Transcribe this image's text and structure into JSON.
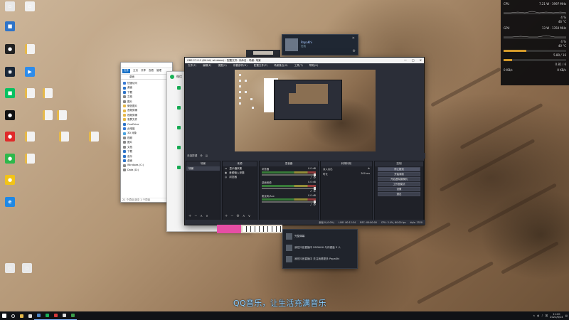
{
  "desktop": {
    "icons": [
      {
        "label": "",
        "color": "#e8e8e8",
        "glyph": "▫"
      },
      {
        "label": "",
        "color": "#f0f0f0",
        "glyph": "▫"
      },
      {
        "label": "",
        "color": "#2f74c8",
        "glyph": "■"
      },
      {
        "label": "",
        "color": "#222222",
        "glyph": "●"
      },
      {
        "label": "",
        "color": "#1b2838",
        "glyph": "◉"
      },
      {
        "label": "",
        "color": "#2d8ceb",
        "glyph": "▶"
      },
      {
        "label": "",
        "color": "#07c160",
        "glyph": "■"
      },
      {
        "label": "",
        "color": "#111111",
        "glyph": "●"
      },
      {
        "label": "",
        "color": "#e02a2a",
        "glyph": "●"
      },
      {
        "label": "",
        "color": "#2eb84b",
        "glyph": "●"
      },
      {
        "label": "",
        "color": "#f2c318",
        "glyph": "●"
      },
      {
        "label": "",
        "color": "#1e88e5",
        "glyph": "e"
      },
      {
        "label": "",
        "color": "#e8e8e8",
        "glyph": "▫"
      },
      {
        "label": "",
        "color": "#e8e8e8",
        "glyph": "▫"
      }
    ]
  },
  "hwmon": {
    "cpu_label": "CPU",
    "cpu_detail": "7.21 W  ·  3997 MHz",
    "cpu_usage": "4 %",
    "cpu_temp": "46 °C",
    "gpu_label": "GPU",
    "gpu_detail": "13 W  ·  1350 MHz",
    "gpu_usage": "4 %",
    "gpu_temp": "40 °C",
    "ram_value": "5.80 / 16",
    "vram_value": "0.81 / 6",
    "net_down": "0 KB/s",
    "net_up": "0 KB/s"
  },
  "explorer": {
    "tabs": [
      "文件",
      "主页",
      "共享",
      "查看",
      "管理"
    ],
    "path": "桌面",
    "nav": [
      {
        "label": "快速访问",
        "color": "#3a7bd5"
      },
      {
        "label": "桌面",
        "color": "#2f74c8"
      },
      {
        "label": "下载",
        "color": "#2f74c8"
      },
      {
        "label": "文档",
        "color": "#888888"
      },
      {
        "label": "图片",
        "color": "#888888"
      },
      {
        "label": "微信图片",
        "color": "#e6b94a"
      },
      {
        "label": "音频剪辑",
        "color": "#e6b94a"
      },
      {
        "label": "视频剪辑",
        "color": "#e6b94a"
      },
      {
        "label": "录屏文件",
        "color": "#e6b94a"
      },
      {
        "label": "OneDrive",
        "color": "#2f74c8"
      },
      {
        "label": "此电脑",
        "color": "#3a7bd5"
      },
      {
        "label": "3D 对象",
        "color": "#4aa3df"
      },
      {
        "label": "视频",
        "color": "#888888"
      },
      {
        "label": "图片",
        "color": "#888888"
      },
      {
        "label": "文档",
        "color": "#888888"
      },
      {
        "label": "下载",
        "color": "#2f74c8"
      },
      {
        "label": "音乐",
        "color": "#2f74c8"
      },
      {
        "label": "桌面",
        "color": "#2f74c8"
      },
      {
        "label": "Windows (C:)",
        "color": "#888888"
      },
      {
        "label": "Data (D:)",
        "color": "#888888"
      }
    ],
    "status": "21 个项目  选中 1 个项目"
  },
  "greenapp": {
    "title": "微信"
  },
  "steam_popup": {
    "name": "PapaKhi",
    "status": "在线"
  },
  "notifications": [
    {
      "text": "完整弹幕"
    },
    {
      "text": "我在抖音直播中  PAPAKHI·与你重逢 3 人"
    },
    {
      "text": "我在抖音直播中  关注我看更多 PapaKhi"
    }
  ],
  "obs": {
    "title": "OBS 27.0.1 (64-bit, windows) - 配置文件: 未命名 - 场景: 场景",
    "window_controls": [
      "—",
      "□",
      "✕"
    ],
    "menu": [
      "文件(F)",
      "编辑(E)",
      "视图(V)",
      "停靠部件(D)",
      "配置文件(P)",
      "场景集合(S)",
      "工具(T)",
      "帮助(H)"
    ],
    "toolbar_text": "未选择源",
    "docks": {
      "scenes": {
        "title": "场景",
        "items": [
          "场景"
        ]
      },
      "sources": {
        "title": "来源",
        "items": [
          "显示器采集",
          "音频输入采集",
          "浏览器"
        ]
      },
      "mixer": {
        "title": "混音器",
        "channels": [
          {
            "name": "浏览器",
            "db": "0.0 dB"
          },
          {
            "name": "桌面音频",
            "db": "0.0 dB"
          },
          {
            "name": "麦克风/Aux",
            "db": "0.0 dB"
          }
        ]
      },
      "transitions": {
        "title": "转场特效",
        "type": "淡入淡出",
        "duration_label": "时长",
        "duration": "300 ms"
      },
      "controls": {
        "title": "控制",
        "buttons": [
          "停止推流",
          "开始录制",
          "开启虚拟摄像机",
          "工作室模式",
          "设置",
          "退出"
        ]
      }
    },
    "status": {
      "dropped": "丢帧 0 (0.0%)",
      "live": "LIVE: 00:12:34",
      "rec": "REC: 00:00:00",
      "cpu": "CPU: 3.4%, 60.00 fps",
      "kbps": "kb/s: 2520"
    }
  },
  "lyrics": "QQ音乐，让生活充满音乐",
  "taskbar": {
    "apps": [
      {
        "name": "windows-start-icon",
        "color": "#ffffff"
      },
      {
        "name": "search-icon",
        "color": "#dddddd"
      },
      {
        "name": "file-explorer-icon",
        "color": "#e6b94a"
      },
      {
        "name": "task-view-icon",
        "color": "#dddddd"
      },
      {
        "name": "steam-icon",
        "color": "#4f86c6"
      },
      {
        "name": "wechat-icon",
        "color": "#19b257"
      },
      {
        "name": "netease-icon",
        "color": "#d63a3a"
      },
      {
        "name": "obs-icon",
        "color": "#dddddd"
      },
      {
        "name": "chrome-icon",
        "color": "#3a9d4a"
      }
    ],
    "tray_text": "英",
    "time": "11:20",
    "date": "2021/6/14"
  }
}
